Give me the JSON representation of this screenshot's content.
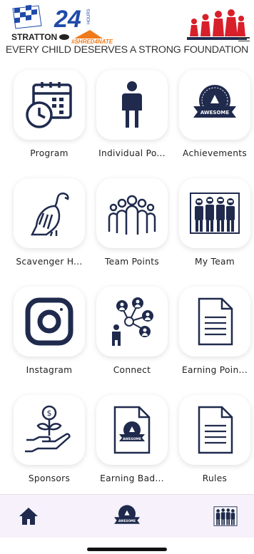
{
  "header": {
    "logo_text": "STRATTON",
    "logo_number": "24",
    "logo_hours": "HOURS",
    "logo_hashtag": "#SHRED4NATE",
    "tagline": "EVERY CHILD DESERVES A STRONG FOUNDATION"
  },
  "tiles": [
    {
      "label": "Program",
      "icon": "calendar-clock-icon"
    },
    {
      "label": "Individual Po...",
      "icon": "person-icon"
    },
    {
      "label": "Achievements",
      "icon": "awesome-badge-icon"
    },
    {
      "label": "Scavenger H...",
      "icon": "vulture-icon"
    },
    {
      "label": "Team Points",
      "icon": "team-group-icon"
    },
    {
      "label": "My Team",
      "icon": "team-photo-icon"
    },
    {
      "label": "Instagram",
      "icon": "instagram-icon"
    },
    {
      "label": "Connect",
      "icon": "network-people-icon"
    },
    {
      "label": "Earning Poin...",
      "icon": "document-icon"
    },
    {
      "label": "Sponsors",
      "icon": "money-plant-hand-icon"
    },
    {
      "label": "Earning Bad...",
      "icon": "badge-document-icon"
    },
    {
      "label": "Rules",
      "icon": "document-icon"
    }
  ],
  "badge_text": "AWESOME",
  "tabbar": [
    {
      "name": "home",
      "icon": "home-icon"
    },
    {
      "name": "achievements",
      "icon": "awesome-badge-icon"
    },
    {
      "name": "team",
      "icon": "team-photo-icon"
    }
  ],
  "colors": {
    "icon_navy": "#1f2a4d",
    "logo_blue": "#1f4aa8",
    "logo_orange": "#f07a1a",
    "logo_red": "#d8202a",
    "tabbar_bg": "#f6f1fb"
  }
}
